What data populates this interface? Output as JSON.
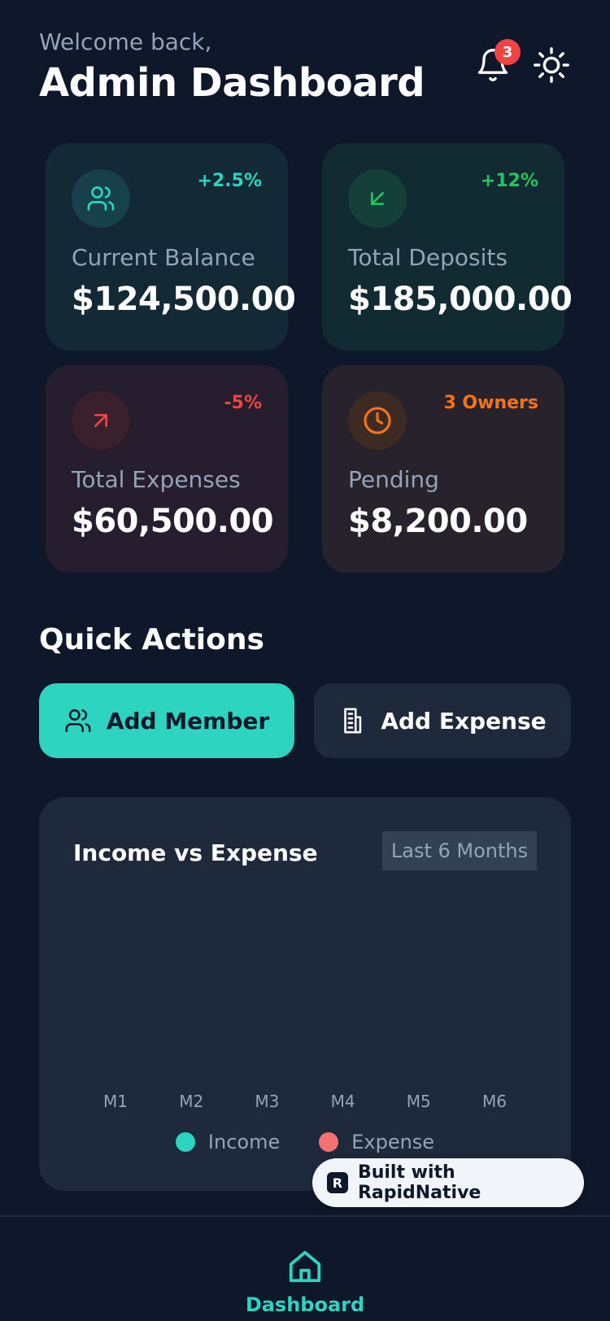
{
  "header": {
    "welcome": "Welcome back,",
    "title": "Admin Dashboard",
    "notification_count": "3",
    "icons": [
      "bell-icon",
      "sun-icon"
    ]
  },
  "stats": [
    {
      "label": "Current Balance",
      "value": "$124,500.00",
      "change": "+2.5%",
      "icon": "users-icon",
      "accent": "#2dd4bf",
      "bg": "#132a36",
      "icon_bg": "#16404a"
    },
    {
      "label": "Total Deposits",
      "value": "$185,000.00",
      "change": "+12%",
      "icon": "arrow-down-left-icon",
      "accent": "#22c55e",
      "bg": "#122a32",
      "icon_bg": "#15403a"
    },
    {
      "label": "Total Expenses",
      "value": "$60,500.00",
      "change": "-5%",
      "icon": "arrow-up-right-icon",
      "accent": "#ef4444",
      "bg": "#261d2f",
      "icon_bg": "#3a1f2c"
    },
    {
      "label": "Pending",
      "value": "$8,200.00",
      "change": "3 Owners",
      "icon": "clock-icon",
      "accent": "#f97316",
      "bg": "#27222b",
      "icon_bg": "#3d2a22"
    }
  ],
  "quick_actions": {
    "title": "Quick Actions",
    "add_member": "Add Member",
    "add_expense": "Add Expense"
  },
  "chart_section": {
    "title": "Income vs Expense",
    "range": "Last 6 Months"
  },
  "chart_data": {
    "type": "bar",
    "categories": [
      "M1",
      "M2",
      "M3",
      "M4",
      "M5",
      "M6"
    ],
    "series": [
      {
        "name": "Income",
        "color": "#2dd4bf",
        "values": []
      },
      {
        "name": "Expense",
        "color": "#f87171",
        "values": []
      }
    ],
    "legend_position": "bottom-center"
  },
  "badge": {
    "text": "Built with RapidNative"
  },
  "nav": {
    "active_label": "Dashboard",
    "icon": "home-icon",
    "accent": "#2dd4bf"
  }
}
